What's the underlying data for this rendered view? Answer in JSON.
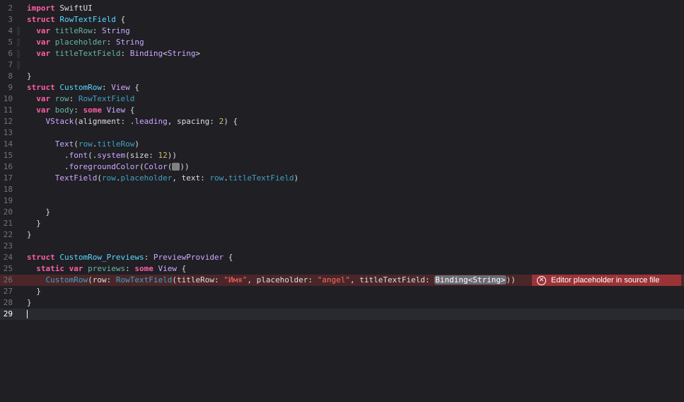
{
  "editor": {
    "lines": [
      {
        "num": "2",
        "tokens": [
          {
            "t": "import",
            "c": "kw"
          },
          {
            "t": " SwiftUI",
            "c": "plain"
          }
        ]
      },
      {
        "num": "3",
        "tokens": [
          {
            "t": "struct",
            "c": "kw"
          },
          {
            "t": " ",
            "c": "plain"
          },
          {
            "t": "RowTextField",
            "c": "type"
          },
          {
            "t": " {",
            "c": "plain"
          }
        ]
      },
      {
        "num": "4",
        "bar": true,
        "tokens": [
          {
            "t": "  ",
            "c": "plain"
          },
          {
            "t": "var",
            "c": "kw"
          },
          {
            "t": " ",
            "c": "plain"
          },
          {
            "t": "titleRow",
            "c": "prop"
          },
          {
            "t": ": ",
            "c": "plain"
          },
          {
            "t": "String",
            "c": "ptype"
          }
        ]
      },
      {
        "num": "5",
        "bar": true,
        "tokens": [
          {
            "t": "  ",
            "c": "plain"
          },
          {
            "t": "var",
            "c": "kw"
          },
          {
            "t": " ",
            "c": "plain"
          },
          {
            "t": "placeholder",
            "c": "prop"
          },
          {
            "t": ": ",
            "c": "plain"
          },
          {
            "t": "String",
            "c": "ptype"
          }
        ]
      },
      {
        "num": "6",
        "bar": true,
        "tokens": [
          {
            "t": "  ",
            "c": "plain"
          },
          {
            "t": "var",
            "c": "kw"
          },
          {
            "t": " ",
            "c": "plain"
          },
          {
            "t": "titleTextField",
            "c": "prop"
          },
          {
            "t": ": ",
            "c": "plain"
          },
          {
            "t": "Binding",
            "c": "ptype"
          },
          {
            "t": "<",
            "c": "plain"
          },
          {
            "t": "String",
            "c": "ptype"
          },
          {
            "t": ">",
            "c": "plain"
          }
        ]
      },
      {
        "num": "7",
        "bar": true,
        "tokens": []
      },
      {
        "num": "8",
        "tokens": [
          {
            "t": "}",
            "c": "plain"
          }
        ]
      },
      {
        "num": "9",
        "tokens": [
          {
            "t": "struct",
            "c": "kw"
          },
          {
            "t": " ",
            "c": "plain"
          },
          {
            "t": "CustomRow",
            "c": "type"
          },
          {
            "t": ": ",
            "c": "plain"
          },
          {
            "t": "View",
            "c": "ptype"
          },
          {
            "t": " {",
            "c": "plain"
          }
        ]
      },
      {
        "num": "10",
        "tokens": [
          {
            "t": "  ",
            "c": "plain"
          },
          {
            "t": "var",
            "c": "kw"
          },
          {
            "t": " ",
            "c": "plain"
          },
          {
            "t": "row",
            "c": "prop"
          },
          {
            "t": ": ",
            "c": "plain"
          },
          {
            "t": "RowTextField",
            "c": "ident"
          }
        ]
      },
      {
        "num": "11",
        "tokens": [
          {
            "t": "  ",
            "c": "plain"
          },
          {
            "t": "var",
            "c": "kw"
          },
          {
            "t": " ",
            "c": "plain"
          },
          {
            "t": "body",
            "c": "prop"
          },
          {
            "t": ": ",
            "c": "plain"
          },
          {
            "t": "some",
            "c": "kw"
          },
          {
            "t": " ",
            "c": "plain"
          },
          {
            "t": "View",
            "c": "ptype"
          },
          {
            "t": " {",
            "c": "plain"
          }
        ]
      },
      {
        "num": "12",
        "tokens": [
          {
            "t": "    ",
            "c": "plain"
          },
          {
            "t": "VStack",
            "c": "ptype"
          },
          {
            "t": "(alignment: .",
            "c": "plain"
          },
          {
            "t": "leading",
            "c": "ptype"
          },
          {
            "t": ", spacing: ",
            "c": "plain"
          },
          {
            "t": "2",
            "c": "num"
          },
          {
            "t": ") {",
            "c": "plain"
          }
        ]
      },
      {
        "num": "13",
        "tokens": []
      },
      {
        "num": "14",
        "tokens": [
          {
            "t": "      ",
            "c": "plain"
          },
          {
            "t": "Text",
            "c": "ptype"
          },
          {
            "t": "(",
            "c": "plain"
          },
          {
            "t": "row",
            "c": "ident"
          },
          {
            "t": ".",
            "c": "plain"
          },
          {
            "t": "titleRow",
            "c": "ident"
          },
          {
            "t": ")",
            "c": "plain"
          }
        ]
      },
      {
        "num": "15",
        "tokens": [
          {
            "t": "        .",
            "c": "plain"
          },
          {
            "t": "font",
            "c": "ptype"
          },
          {
            "t": "(.",
            "c": "plain"
          },
          {
            "t": "system",
            "c": "ptype"
          },
          {
            "t": "(size: ",
            "c": "plain"
          },
          {
            "t": "12",
            "c": "num"
          },
          {
            "t": "))",
            "c": "plain"
          }
        ]
      },
      {
        "num": "16",
        "tokens": [
          {
            "t": "        .",
            "c": "plain"
          },
          {
            "t": "foregroundColor",
            "c": "ptype"
          },
          {
            "t": "(",
            "c": "plain"
          },
          {
            "t": "Color",
            "c": "ptype"
          },
          {
            "t": "(",
            "c": "plain"
          },
          {
            "t": "",
            "c": "swatch"
          },
          {
            "t": "))",
            "c": "plain"
          }
        ]
      },
      {
        "num": "17",
        "tokens": [
          {
            "t": "      ",
            "c": "plain"
          },
          {
            "t": "TextField",
            "c": "ptype"
          },
          {
            "t": "(",
            "c": "plain"
          },
          {
            "t": "row",
            "c": "ident"
          },
          {
            "t": ".",
            "c": "plain"
          },
          {
            "t": "placeholder",
            "c": "ident"
          },
          {
            "t": ", text: ",
            "c": "plain"
          },
          {
            "t": "row",
            "c": "ident"
          },
          {
            "t": ".",
            "c": "plain"
          },
          {
            "t": "titleTextField",
            "c": "ident"
          },
          {
            "t": ")",
            "c": "plain"
          }
        ]
      },
      {
        "num": "18",
        "tokens": []
      },
      {
        "num": "19",
        "tokens": []
      },
      {
        "num": "20",
        "tokens": [
          {
            "t": "    }",
            "c": "plain"
          }
        ]
      },
      {
        "num": "21",
        "tokens": [
          {
            "t": "  }",
            "c": "plain"
          }
        ]
      },
      {
        "num": "22",
        "tokens": [
          {
            "t": "}",
            "c": "plain"
          }
        ]
      },
      {
        "num": "23",
        "tokens": []
      },
      {
        "num": "24",
        "tokens": [
          {
            "t": "struct",
            "c": "kw"
          },
          {
            "t": " ",
            "c": "plain"
          },
          {
            "t": "CustomRow_Previews",
            "c": "type"
          },
          {
            "t": ": ",
            "c": "plain"
          },
          {
            "t": "PreviewProvider",
            "c": "ptype"
          },
          {
            "t": " {",
            "c": "plain"
          }
        ]
      },
      {
        "num": "25",
        "tokens": [
          {
            "t": "  ",
            "c": "plain"
          },
          {
            "t": "static",
            "c": "kw"
          },
          {
            "t": " ",
            "c": "plain"
          },
          {
            "t": "var",
            "c": "kw"
          },
          {
            "t": " ",
            "c": "plain"
          },
          {
            "t": "previews",
            "c": "prop"
          },
          {
            "t": ": ",
            "c": "plain"
          },
          {
            "t": "some",
            "c": "kw"
          },
          {
            "t": " ",
            "c": "plain"
          },
          {
            "t": "View",
            "c": "ptype"
          },
          {
            "t": " {",
            "c": "plain"
          }
        ]
      },
      {
        "num": "26",
        "error": true,
        "tokens": [
          {
            "t": "    ",
            "c": "plain"
          },
          {
            "t": "CustomRow",
            "c": "ident"
          },
          {
            "t": "(row: ",
            "c": "plain"
          },
          {
            "t": "RowTextField",
            "c": "ident"
          },
          {
            "t": "(titleRow: ",
            "c": "plain"
          },
          {
            "t": "\"Имя\"",
            "c": "str"
          },
          {
            "t": ", placeholder: ",
            "c": "plain"
          },
          {
            "t": "\"angel\"",
            "c": "str"
          },
          {
            "t": ", titleTextField: ",
            "c": "plain"
          },
          {
            "t": "Binding<String>",
            "c": "token-ph"
          },
          {
            "t": "))",
            "c": "plain"
          }
        ]
      },
      {
        "num": "27",
        "tokens": [
          {
            "t": "  }",
            "c": "plain"
          }
        ]
      },
      {
        "num": "28",
        "tokens": [
          {
            "t": "}",
            "c": "plain"
          }
        ]
      },
      {
        "num": "29",
        "current": true,
        "tokens": []
      }
    ],
    "error_message": "Editor placeholder in source file",
    "error_icon": "error-circle-x-icon",
    "error_glyph": "✕"
  },
  "colors": {
    "background": "#1f1f24",
    "keyword": "#fc5fa3",
    "type_decl": "#5dd8ff",
    "property": "#67b7a4",
    "other_type": "#d0a8ff",
    "identifier": "#41a1c0",
    "number": "#d0bf69",
    "string": "#fc6a5d",
    "error_line": "#4a2629",
    "error_badge": "#9b3337"
  }
}
